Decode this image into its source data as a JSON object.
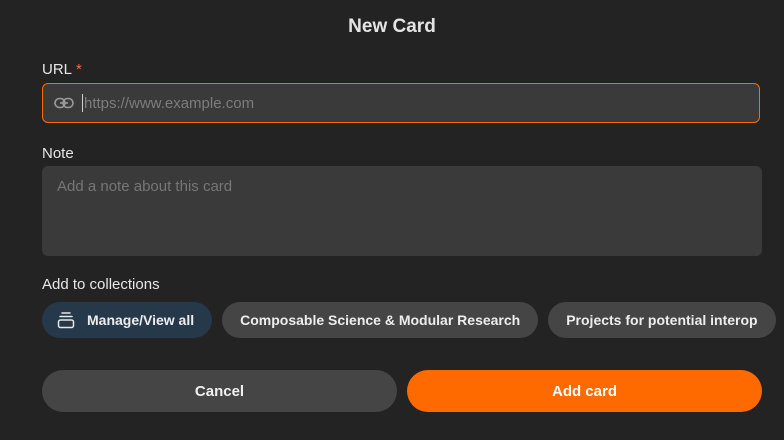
{
  "dialog": {
    "title": "New Card"
  },
  "url_field": {
    "label": "URL",
    "required_marker": "*",
    "value": "",
    "placeholder": "https://www.example.com",
    "icon": "link-icon"
  },
  "note_field": {
    "label": "Note",
    "value": "",
    "placeholder": "Add a note about this card"
  },
  "collections": {
    "label": "Add to collections",
    "manage_label": "Manage/View all",
    "manage_icon": "stack-icon",
    "items": [
      {
        "label": "Composable Science & Modular Research"
      },
      {
        "label": "Projects for potential interop"
      }
    ]
  },
  "actions": {
    "cancel_label": "Cancel",
    "submit_label": "Add card"
  },
  "colors": {
    "accent": "#ff6a00",
    "background": "#232323",
    "field": "#3a3a3a",
    "chip": "#454545",
    "manage_chip": "#25394a"
  }
}
